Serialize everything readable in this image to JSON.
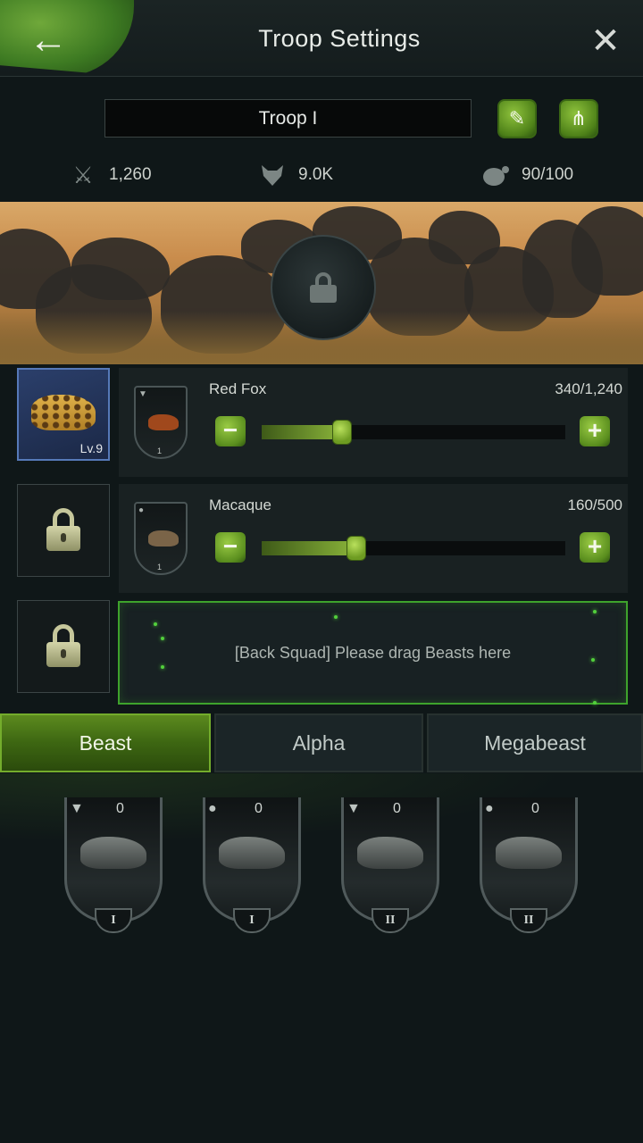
{
  "header": {
    "title": "Troop Settings",
    "back_icon": "←",
    "close_icon": "✕"
  },
  "troop": {
    "name": "Troop I"
  },
  "buttons": {
    "edit_icon": "✎",
    "share_icon": "⋔"
  },
  "stats": {
    "attack": "1,260",
    "power": "9.0K",
    "capacity": "90/100"
  },
  "leader": {
    "level": "Lv.9"
  },
  "units": [
    {
      "name": "Red Fox",
      "count": "340/1,240",
      "tier": "1",
      "fill_fraction": 0.26,
      "color": "#a0481c"
    },
    {
      "name": "Macaque",
      "count": "160/500",
      "tier": "1",
      "fill_fraction": 0.31,
      "color": "#7a6448"
    }
  ],
  "controls": {
    "minus": "−",
    "plus": "+"
  },
  "back_squad": {
    "text": "[Back Squad] Please drag Beasts here"
  },
  "tabs": [
    "Beast",
    "Alpha",
    "Megabeast"
  ],
  "beasts": [
    {
      "count": "0",
      "tier": "I",
      "type": "wolf"
    },
    {
      "count": "0",
      "tier": "I",
      "type": "primate"
    },
    {
      "count": "0",
      "tier": "II",
      "type": "wolf"
    },
    {
      "count": "0",
      "tier": "II",
      "type": "primate"
    }
  ]
}
